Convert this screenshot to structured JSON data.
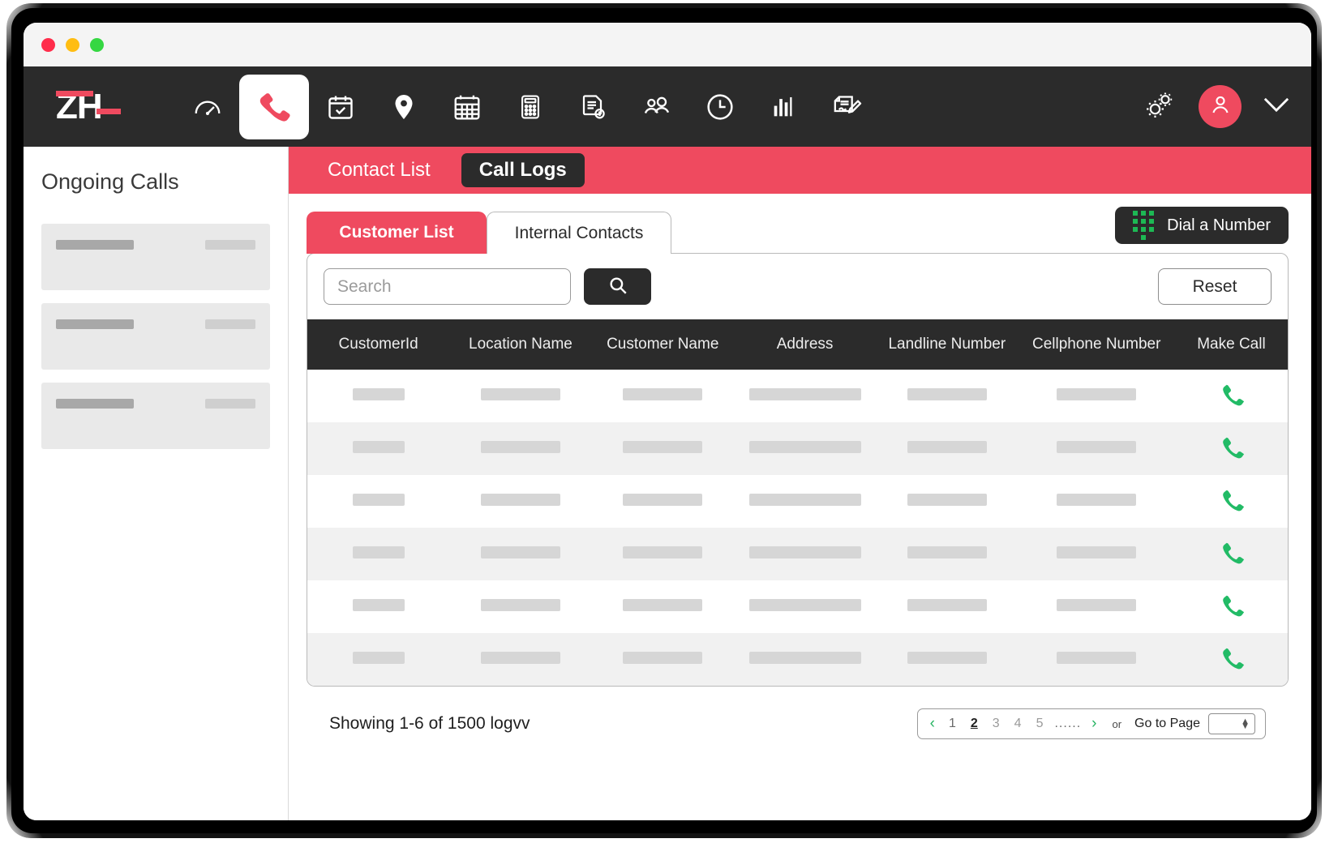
{
  "window": {
    "traffic_lights": [
      "close",
      "minimize",
      "maximize"
    ]
  },
  "brand": {
    "logo_text": "ZH"
  },
  "topnav": {
    "items": [
      {
        "name": "dashboard",
        "icon": "speedometer-icon",
        "active": false
      },
      {
        "name": "calls",
        "icon": "phone-icon",
        "active": true
      },
      {
        "name": "scheduled-tasks",
        "icon": "calendar-check-icon",
        "active": false
      },
      {
        "name": "locations",
        "icon": "map-pin-icon",
        "active": false
      },
      {
        "name": "calendar",
        "icon": "calendar-icon",
        "active": false
      },
      {
        "name": "calculator",
        "icon": "calculator-icon",
        "active": false
      },
      {
        "name": "invoices",
        "icon": "document-dollar-icon",
        "active": false
      },
      {
        "name": "customers",
        "icon": "people-icon",
        "active": false
      },
      {
        "name": "timesheet",
        "icon": "clock-icon",
        "active": false
      },
      {
        "name": "reports",
        "icon": "bar-chart-icon",
        "active": false
      },
      {
        "name": "work-orders",
        "icon": "document-pen-icon",
        "active": false
      }
    ],
    "settings_icon": "gears-icon",
    "avatar_icon": "user-avatar-icon",
    "dropdown_icon": "chevron-down-icon"
  },
  "sidebar": {
    "title": "Ongoing Calls",
    "cards": [
      {
        "name": "ongoing-call-card-1"
      },
      {
        "name": "ongoing-call-card-2"
      },
      {
        "name": "ongoing-call-card-3"
      }
    ]
  },
  "header_tabs": {
    "items": [
      {
        "label": "Contact List",
        "active": false
      },
      {
        "label": "Call Logs",
        "active": true
      }
    ]
  },
  "subtabs": {
    "items": [
      {
        "label": "Customer List",
        "active": true
      },
      {
        "label": "Internal Contacts",
        "active": false
      }
    ]
  },
  "dial_button": {
    "label": "Dial a Number",
    "icon": "dialpad-icon"
  },
  "search": {
    "placeholder": "Search",
    "value": "",
    "button_icon": "search-icon",
    "reset_label": "Reset"
  },
  "table": {
    "columns": [
      "CustomerId",
      "Location Name",
      "Customer Name",
      "Address",
      "Landline Number",
      "Cellphone Number",
      "Make Call"
    ],
    "row_count": 6,
    "call_icon": "phone-handset-icon",
    "skeleton_widths": [
      64,
      98,
      98,
      138,
      98,
      98
    ]
  },
  "footer": {
    "showing": "Showing 1-6 of 1500 logvv",
    "pagination": {
      "prev_icon": "chevron-left-icon",
      "next_icon": "chevron-right-icon",
      "pages": [
        "1",
        "2",
        "3",
        "4",
        "5"
      ],
      "current_page": "2",
      "ellipsis": "......",
      "or_label": "or",
      "goto_label": "Go to Page",
      "goto_value": ""
    }
  },
  "colors": {
    "accent_red": "#ef4a5f",
    "dark": "#2b2b2b",
    "green": "#1db954",
    "pager_green": "#28b463"
  }
}
